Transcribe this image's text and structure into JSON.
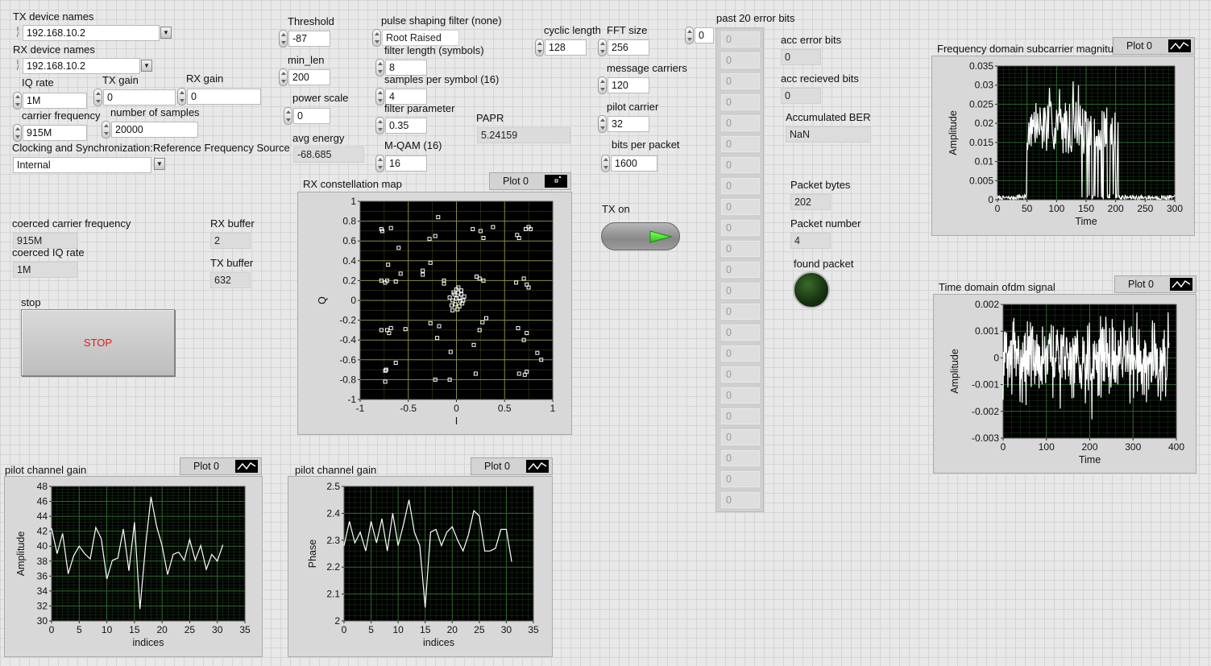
{
  "tx_device": {
    "label": "TX device names",
    "value": "192.168.10.2"
  },
  "rx_device": {
    "label": "RX device names",
    "value": "192.168.10.2"
  },
  "iq_rate": {
    "label": "IQ rate",
    "value": "1M"
  },
  "tx_gain": {
    "label": "TX gain",
    "value": "0"
  },
  "rx_gain": {
    "label": "RX gain",
    "value": "0"
  },
  "carrier_frequency": {
    "label": "carrier frequency",
    "value": "915M"
  },
  "number_of_samples": {
    "label": "number of samples",
    "value": "20000"
  },
  "ref_source": {
    "label": "Clocking and Synchronization:Reference Frequency Source",
    "value": "Internal"
  },
  "threshold": {
    "label": "Threshold",
    "value": "-87"
  },
  "min_len": {
    "label": "min_len",
    "value": "200"
  },
  "power_scale": {
    "label": "power scale",
    "value": "0"
  },
  "avg_energy": {
    "label": "avg energy",
    "value": "-68.685"
  },
  "pulse_filter": {
    "label": "pulse shaping filter (none)",
    "value": "Root Raised"
  },
  "filter_length": {
    "label": "filter length (symbols)",
    "value": "8"
  },
  "samples_per_symbol": {
    "label": "samples per symbol (16)",
    "value": "4"
  },
  "filter_parameter": {
    "label": "filter parameter",
    "value": "0.35"
  },
  "mqam": {
    "label": "M-QAM (16)",
    "value": "16"
  },
  "papr": {
    "label": "PAPR",
    "value": "5.24159"
  },
  "cyclic_length": {
    "label": "cyclic length",
    "value": "128"
  },
  "fft_size": {
    "label": "FFT size",
    "value": "256"
  },
  "message_carriers": {
    "label": "message carriers",
    "value": "120"
  },
  "pilot_carrier": {
    "label": "pilot carrier",
    "value": "32"
  },
  "bits_per_packet": {
    "label": "bits per packet",
    "value": "1600"
  },
  "tx_on": {
    "label": "TX on",
    "state": "on"
  },
  "error_bits": {
    "label": "past 20 error bits",
    "index": "0",
    "values": [
      "0",
      "0",
      "0",
      "0",
      "0",
      "0",
      "0",
      "0",
      "0",
      "0",
      "0",
      "0",
      "0",
      "0",
      "0",
      "0",
      "0",
      "0",
      "0",
      "0",
      "0",
      "0",
      "0"
    ]
  },
  "acc_error_bits": {
    "label": "acc error bits",
    "value": "0"
  },
  "acc_received_bits": {
    "label": "acc recieved bits",
    "value": "0"
  },
  "accumulated_ber": {
    "label": "Accumulated BER",
    "value": "NaN"
  },
  "packet_bytes": {
    "label": "Packet bytes",
    "value": "202"
  },
  "packet_number": {
    "label": "Packet number",
    "value": "4"
  },
  "found_packet": {
    "label": "found packet",
    "state": "off"
  },
  "coerced_carrier": {
    "label": "coerced carrier frequency",
    "value": "915M"
  },
  "coerced_iq": {
    "label": "coerced IQ rate",
    "value": "1M"
  },
  "rx_buffer": {
    "label": "RX buffer",
    "value": "2"
  },
  "tx_buffer": {
    "label": "TX buffer",
    "value": "632"
  },
  "stop": {
    "label": "stop",
    "button": "STOP"
  },
  "colors": {
    "plot_bg": "#000000",
    "grid": "#2f6b2f",
    "constellation_grid": "#8a8a45",
    "trace": "#ffffff",
    "stop_text": "#e01b1b",
    "tx_led": "#2fe21c"
  },
  "chart_data": [
    {
      "id": "freq",
      "type": "line",
      "title": "Frequency domain subcarrier magnitude",
      "legend": "Plot 0",
      "xlabel": "Time",
      "ylabel": "Amplitude",
      "xlim": [
        0,
        300
      ],
      "ylim": [
        0,
        0.035
      ],
      "xticks": [
        "0",
        "50",
        "100",
        "150",
        "200",
        "250",
        "300"
      ],
      "yticks": [
        "0",
        "0.005",
        "0.01",
        "0.015",
        "0.02",
        "0.025",
        "0.03",
        "0.035"
      ],
      "grid": true
    },
    {
      "id": "time",
      "type": "line",
      "title": "Time domain ofdm signal",
      "legend": "Plot 0",
      "xlabel": "Time",
      "ylabel": "Amplitude",
      "xlim": [
        0,
        400
      ],
      "ylim": [
        -0.003,
        0.002
      ],
      "xticks": [
        "0",
        "100",
        "200",
        "300",
        "400"
      ],
      "yticks": [
        "-0.003",
        "-0.002",
        "-0.001",
        "0",
        "0.001",
        "0.002"
      ],
      "grid": true
    },
    {
      "id": "const",
      "type": "scatter",
      "title": "RX  constellation map",
      "legend": "Plot 0",
      "xlabel": "I",
      "ylabel": "Q",
      "xlim": [
        -1,
        1
      ],
      "ylim": [
        -1,
        1
      ],
      "xticks": [
        "-1",
        "-0.5",
        "0",
        "0.5",
        "1"
      ],
      "yticks": [
        "-1",
        "-0.8",
        "-0.6",
        "-0.4",
        "-0.2",
        "0",
        "0.2",
        "0.4",
        "0.6",
        "0.8",
        "1"
      ],
      "grid": true,
      "points": [
        [
          -0.78,
          0.72
        ],
        [
          -0.77,
          0.7
        ],
        [
          -0.68,
          0.73
        ],
        [
          -0.6,
          0.53
        ],
        [
          -0.71,
          0.36
        ],
        [
          -0.58,
          0.27
        ],
        [
          -0.78,
          0.2
        ],
        [
          -0.72,
          0.2
        ],
        [
          -0.74,
          0.18
        ],
        [
          -0.63,
          0.19
        ],
        [
          -0.78,
          -0.3
        ],
        [
          -0.72,
          -0.3
        ],
        [
          -0.7,
          -0.33
        ],
        [
          -0.68,
          -0.28
        ],
        [
          -0.63,
          -0.63
        ],
        [
          -0.74,
          -0.71
        ],
        [
          -0.73,
          -0.7
        ],
        [
          -0.74,
          -0.82
        ],
        [
          -0.53,
          -0.29
        ],
        [
          -0.27,
          -0.23
        ],
        [
          -0.35,
          0.26
        ],
        [
          -0.35,
          0.3
        ],
        [
          -0.27,
          0.38
        ],
        [
          -0.22,
          0.65
        ],
        [
          -0.28,
          0.62
        ],
        [
          -0.19,
          0.84
        ],
        [
          -0.13,
          0.2
        ],
        [
          -0.13,
          0.17
        ],
        [
          -0.18,
          -0.26
        ],
        [
          -0.2,
          -0.38
        ],
        [
          -0.06,
          -0.52
        ],
        [
          -0.22,
          -0.8
        ],
        [
          -0.07,
          -0.8
        ],
        [
          0.17,
          0.72
        ],
        [
          0.25,
          0.7
        ],
        [
          0.28,
          0.63
        ],
        [
          0.38,
          0.74
        ],
        [
          0.21,
          0.24
        ],
        [
          0.24,
          0.22
        ],
        [
          0.28,
          0.2
        ],
        [
          0.27,
          -0.22
        ],
        [
          0.24,
          -0.3
        ],
        [
          0.31,
          -0.18
        ],
        [
          0.18,
          -0.45
        ],
        [
          0.2,
          -0.74
        ],
        [
          0.63,
          0.66
        ],
        [
          0.65,
          0.63
        ],
        [
          0.72,
          0.72
        ],
        [
          0.75,
          0.74
        ],
        [
          0.77,
          0.72
        ],
        [
          0.62,
          0.18
        ],
        [
          0.7,
          0.22
        ],
        [
          0.73,
          0.16
        ],
        [
          0.75,
          0.13
        ],
        [
          0.64,
          -0.28
        ],
        [
          0.7,
          -0.4
        ],
        [
          0.73,
          -0.33
        ],
        [
          0.84,
          -0.53
        ],
        [
          0.88,
          -0.6
        ],
        [
          0.65,
          -0.74
        ],
        [
          0.71,
          -0.75
        ],
        [
          0.73,
          -0.72
        ],
        [
          -0.02,
          0.06
        ],
        [
          0.0,
          0.02
        ],
        [
          0.02,
          0.08
        ],
        [
          0.04,
          -0.01
        ],
        [
          -0.01,
          -0.04
        ],
        [
          0.03,
          0.03
        ],
        [
          0.05,
          0.1
        ],
        [
          -0.04,
          0.0
        ],
        [
          0.0,
          0.11
        ],
        [
          0.06,
          -0.03
        ],
        [
          -0.05,
          -0.05
        ],
        [
          0.03,
          -0.06
        ],
        [
          0.08,
          0.04
        ],
        [
          -0.03,
          0.08
        ],
        [
          0.01,
          -0.09
        ],
        [
          -0.07,
          0.03
        ],
        [
          0.07,
          0.0
        ],
        [
          0.02,
          0.13
        ],
        [
          -0.04,
          -0.1
        ],
        [
          0.05,
          0.06
        ]
      ]
    },
    {
      "id": "pilot_amp",
      "type": "line",
      "title": "pilot channel gain",
      "legend": "Plot 0",
      "xlabel": "indices",
      "ylabel": "Amplitude",
      "xlim": [
        0,
        35
      ],
      "ylim": [
        30,
        48
      ],
      "xticks": [
        "0",
        "5",
        "10",
        "15",
        "20",
        "25",
        "30",
        "35"
      ],
      "yticks": [
        "30",
        "32",
        "34",
        "36",
        "38",
        "40",
        "42",
        "44",
        "46",
        "48"
      ],
      "grid": true,
      "x": [
        0,
        1,
        2,
        3,
        4,
        5,
        6,
        7,
        8,
        9,
        10,
        11,
        12,
        13,
        14,
        15,
        16,
        17,
        18,
        19,
        20,
        21,
        22,
        23,
        24,
        25,
        26,
        27,
        28,
        29,
        30,
        31
      ],
      "y": [
        42.4,
        39.0,
        41.7,
        36.3,
        38.7,
        40.0,
        39.0,
        38.3,
        42.5,
        41.0,
        35.6,
        38.1,
        38.4,
        42.3,
        36.7,
        43.2,
        31.6,
        40.0,
        46.6,
        42.7,
        40.1,
        36.2,
        38.9,
        39.2,
        38.1,
        40.9,
        38.1,
        40.1,
        36.9,
        38.9,
        38.0,
        40.2
      ]
    },
    {
      "id": "pilot_phase",
      "type": "line",
      "title": "pilot channel gain",
      "legend": "Plot 0",
      "xlabel": "indices",
      "ylabel": "Phase",
      "xlim": [
        0,
        35
      ],
      "ylim": [
        2,
        2.5
      ],
      "xticks": [
        "0",
        "5",
        "10",
        "15",
        "20",
        "25",
        "30",
        "35"
      ],
      "yticks": [
        "2",
        "2.1",
        "2.2",
        "2.3",
        "2.4",
        "2.5"
      ],
      "grid": true,
      "x": [
        0,
        1,
        2,
        3,
        4,
        5,
        6,
        7,
        8,
        9,
        10,
        11,
        12,
        13,
        14,
        15,
        16,
        17,
        18,
        19,
        20,
        21,
        22,
        23,
        24,
        25,
        26,
        27,
        28,
        29,
        30,
        31
      ],
      "y": [
        2.28,
        2.37,
        2.29,
        2.33,
        2.26,
        2.37,
        2.29,
        2.38,
        2.26,
        2.4,
        2.28,
        2.36,
        2.45,
        2.33,
        2.28,
        2.05,
        2.33,
        2.34,
        2.28,
        2.33,
        2.35,
        2.3,
        2.26,
        2.32,
        2.41,
        2.39,
        2.26,
        2.26,
        2.27,
        2.34,
        2.34,
        2.22
      ]
    }
  ]
}
